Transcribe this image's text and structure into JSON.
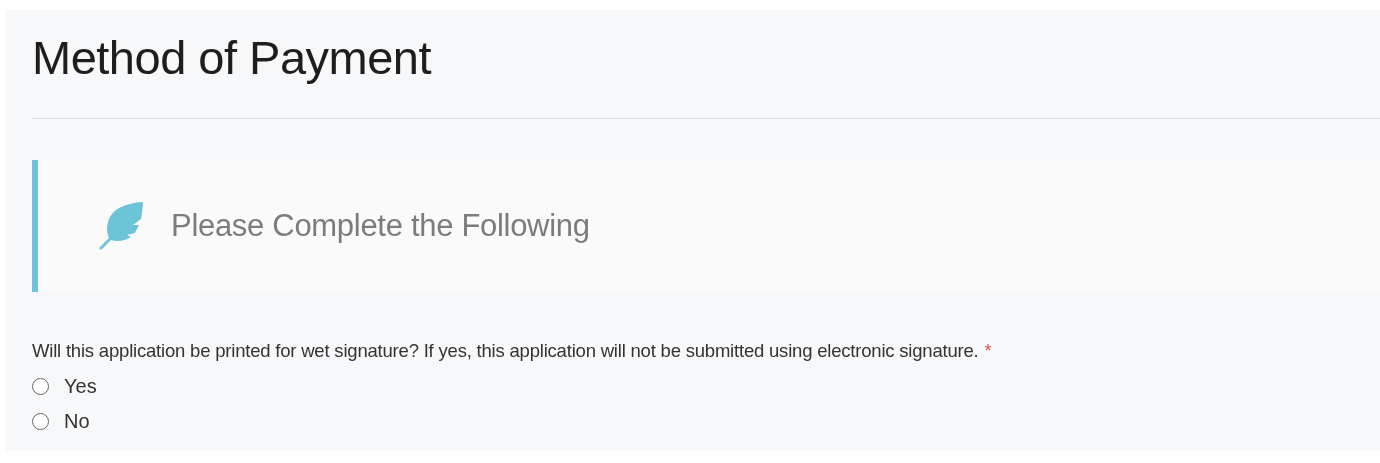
{
  "section": {
    "title": "Method of Payment"
  },
  "callout": {
    "text": "Please Complete the Following"
  },
  "question": {
    "label": "Will this application be printed for wet signature? If yes, this application will not be submitted using electronic signature.",
    "required_mark": "*",
    "options": [
      {
        "label": "Yes",
        "selected": false
      },
      {
        "label": "No",
        "selected": false
      }
    ]
  }
}
